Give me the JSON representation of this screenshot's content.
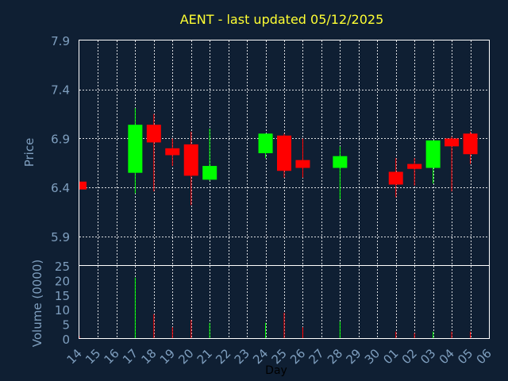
{
  "chart_data": {
    "type": "candlestick",
    "title": "AENT - last updated 05/12/2025",
    "price_panel": {
      "ylabel": "Price",
      "ylim": [
        5.6,
        7.9
      ],
      "yticks": [
        "7.9",
        "7.4",
        "6.9",
        "6.4",
        "5.9"
      ],
      "ytick_values": [
        7.9,
        7.4,
        6.9,
        6.4,
        5.9
      ]
    },
    "volume_panel": {
      "ylabel": "Volume (0000)",
      "ylim": [
        0,
        25
      ],
      "yticks": [
        "25",
        "20",
        "15",
        "10",
        "5",
        "0"
      ],
      "ytick_values": [
        25,
        20,
        15,
        10,
        5,
        0
      ]
    },
    "xlabel": "Day",
    "x_tick_labels": [
      "14",
      "15",
      "16",
      "17",
      "18",
      "19",
      "20",
      "21",
      "22",
      "23",
      "24",
      "25",
      "26",
      "27",
      "28",
      "29",
      "30",
      "01",
      "02",
      "03",
      "04",
      "05",
      "06"
    ],
    "colors": {
      "up": "#00ff00",
      "down": "#ff0000",
      "background": "#0f1f33",
      "grid": "#ffffff",
      "title": "#ffff33",
      "axis_text": "#7f9fbf"
    },
    "candles": [
      {
        "day": "14",
        "open": 6.46,
        "high": 6.46,
        "low": 6.38,
        "close": 6.38,
        "volume": 1.0
      },
      {
        "day": "17",
        "open": 6.55,
        "high": 7.21,
        "low": 6.34,
        "close": 7.04,
        "volume": 21.0
      },
      {
        "day": "18",
        "open": 7.04,
        "high": 7.15,
        "low": 6.36,
        "close": 6.86,
        "volume": 8.5
      },
      {
        "day": "19",
        "open": 6.8,
        "high": 6.9,
        "low": 6.62,
        "close": 6.73,
        "volume": 4.0
      },
      {
        "day": "20",
        "open": 6.84,
        "high": 6.97,
        "low": 6.22,
        "close": 6.52,
        "volume": 6.5
      },
      {
        "day": "21",
        "open": 6.48,
        "high": 7.0,
        "low": 6.47,
        "close": 6.62,
        "volume": 5.5
      },
      {
        "day": "24",
        "open": 6.75,
        "high": 6.95,
        "low": 6.7,
        "close": 6.95,
        "volume": 5.5
      },
      {
        "day": "25",
        "open": 6.93,
        "high": 6.95,
        "low": 6.5,
        "close": 6.57,
        "volume": 9.0
      },
      {
        "day": "26",
        "open": 6.68,
        "high": 6.9,
        "low": 6.5,
        "close": 6.6,
        "volume": 4.0
      },
      {
        "day": "28",
        "open": 6.6,
        "high": 6.82,
        "low": 6.28,
        "close": 6.72,
        "volume": 6.0
      },
      {
        "day": "01",
        "open": 6.56,
        "high": 6.7,
        "low": 6.3,
        "close": 6.43,
        "volume": 2.5
      },
      {
        "day": "02",
        "open": 6.64,
        "high": 6.7,
        "low": 6.42,
        "close": 6.59,
        "volume": 2.0
      },
      {
        "day": "03",
        "open": 6.6,
        "high": 6.88,
        "low": 6.44,
        "close": 6.88,
        "volume": 2.5
      },
      {
        "day": "04",
        "open": 6.9,
        "high": 6.92,
        "low": 6.36,
        "close": 6.82,
        "volume": 2.5
      },
      {
        "day": "05",
        "open": 6.95,
        "high": 6.97,
        "low": 6.64,
        "close": 6.74,
        "volume": 2.5
      }
    ]
  }
}
